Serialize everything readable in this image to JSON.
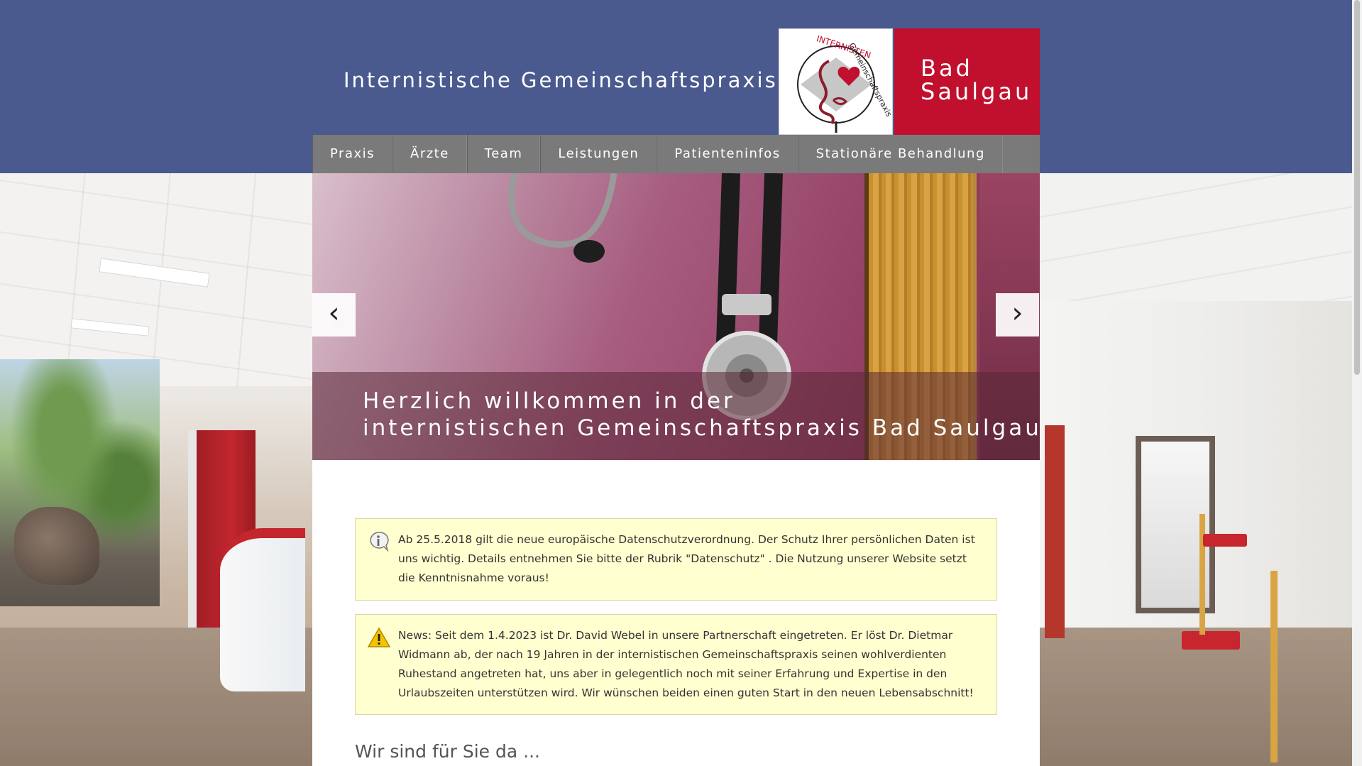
{
  "header": {
    "site_title": "Internistische Gemeinschaftspraxis",
    "brand_line1": "Bad",
    "brand_line2": "Saulgau",
    "logo_text_top": "INTERNISTEN",
    "logo_text_bottom": "Gemeinschaftspraxis",
    "logo_icon": "stomach-heart-logo",
    "colors": {
      "header_bg": "#4a5a8f",
      "brand_red": "#c0102e",
      "nav_bg": "#7a7a7a"
    }
  },
  "nav": {
    "items": [
      {
        "label": "Praxis"
      },
      {
        "label": "Ärzte"
      },
      {
        "label": "Team"
      },
      {
        "label": "Leistungen"
      },
      {
        "label": "Patienteninfos"
      },
      {
        "label": "Stationäre Behandlung"
      }
    ]
  },
  "slider": {
    "caption_line1": "Herzlich willkommen in der",
    "caption_line2": "internistischen Gemeinschaftspraxis Bad Saulgau",
    "prev_icon": "chevron-left-icon",
    "next_icon": "chevron-right-icon",
    "prev_glyph": "‹",
    "next_glyph": "›"
  },
  "notices": [
    {
      "icon": "info-icon",
      "text": "Ab 25.5.2018 gilt die neue europäische Datenschutzverordnung. Der Schutz Ihrer persönlichen Daten ist uns wichtig. Details entnehmen Sie bitte der Rubrik \"Datenschutz\" . Die Nutzung unserer Website setzt die Kenntnisnahme voraus!"
    },
    {
      "icon": "warning-icon",
      "text": "News: Seit dem 1.4.2023 ist Dr. David Webel in unsere Partnerschaft eingetreten. Er löst Dr. Dietmar Widmann ab, der nach 19 Jahren in der internistischen Gemeinschaftspraxis seinen wohlverdienten Ruhestand angetreten hat, uns aber in gelegentlich noch mit seiner Erfahrung und Expertise in den Urlaubszeiten unterstützen wird. Wir wünschen beiden einen guten Start in den neuen Lebensabschnitt!"
    }
  ],
  "main": {
    "heading": "Wir sind für Sie da ..."
  }
}
